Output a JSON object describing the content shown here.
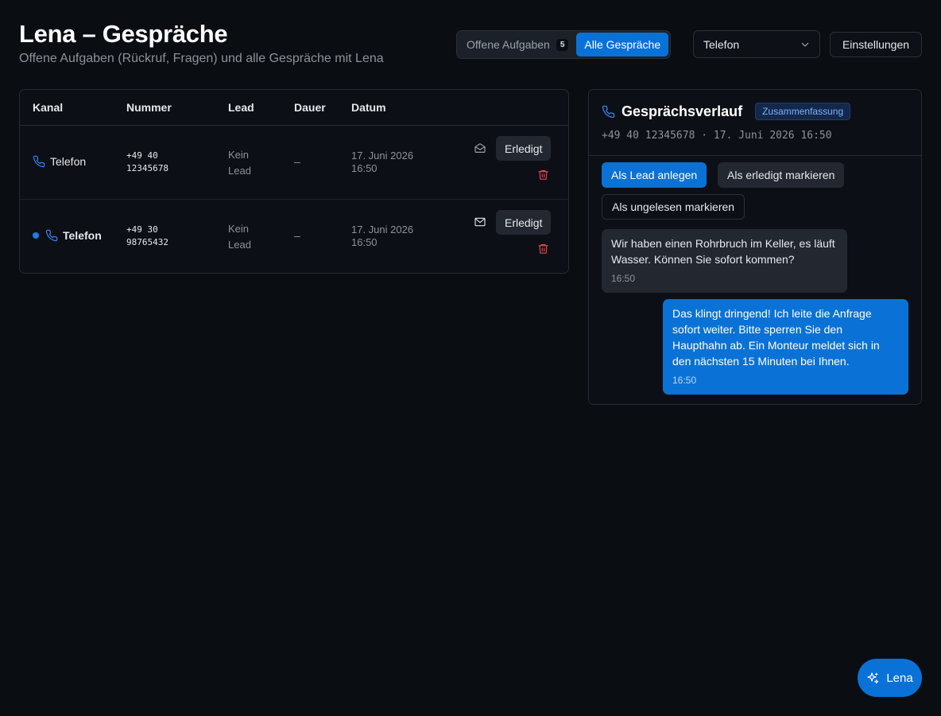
{
  "header": {
    "title": "Lena – Gespräche",
    "subtitle": "Offene Aufgaben (Rückruf, Fragen) und alle Gespräche mit Lena"
  },
  "filters": {
    "open_tasks_label": "Offene Aufgaben",
    "open_tasks_count": "5",
    "all_conversations_label": "Alle Gespräche",
    "channel_select_value": "Telefon",
    "settings_label": "Einstellungen"
  },
  "table": {
    "headers": {
      "kanal": "Kanal",
      "nummer": "Nummer",
      "lead": "Lead",
      "dauer": "Dauer",
      "datum": "Datum"
    },
    "rows": [
      {
        "kanal": "Telefon",
        "nummer_line1": "+49 40",
        "nummer_line2": "12345678",
        "lead_line1": "Kein",
        "lead_line2": "Lead",
        "dauer": "–",
        "datum_line1": "17. Juni 2026",
        "datum_line2": "16:50",
        "action": "Erledigt",
        "unread": false,
        "mail_icon": "mail-open-icon"
      },
      {
        "kanal": "Telefon",
        "nummer_line1": "+49 30",
        "nummer_line2": "98765432",
        "lead_line1": "Kein",
        "lead_line2": "Lead",
        "dauer": "–",
        "datum_line1": "17. Juni 2026",
        "datum_line2": "16:50",
        "action": "Erledigt",
        "unread": true,
        "mail_icon": "mail-icon"
      }
    ]
  },
  "detail": {
    "title": "Gesprächsverlauf",
    "tag": "Zusammenfassung",
    "meta": "+49 40 12345678 · 17. Juni 2026 16:50",
    "actions": {
      "create_lead": "Als Lead anlegen",
      "mark_done": "Als erledigt markieren",
      "mark_unread": "Als ungelesen markieren"
    },
    "messages": [
      {
        "from": "caller",
        "text": "Wir haben einen Rohrbruch im Keller, es läuft Wasser. Können Sie sofort kommen?",
        "time": "16:50"
      },
      {
        "from": "lena",
        "text": "Das klingt dringend! Ich leite die Anfrage sofort weiter. Bitte sperren Sie den Haupthahn ab. Ein Monteur meldet sich in den nächsten 15 Minuten bei Ihnen.",
        "time": "16:50"
      }
    ]
  },
  "assistant_button": {
    "label": "Lena",
    "icon": "sparkles-icon"
  },
  "colors": {
    "background": "#0a0d12",
    "accent": "#0a72d6",
    "danger": "#e5484d",
    "phone_icon": "#3b82f6"
  }
}
